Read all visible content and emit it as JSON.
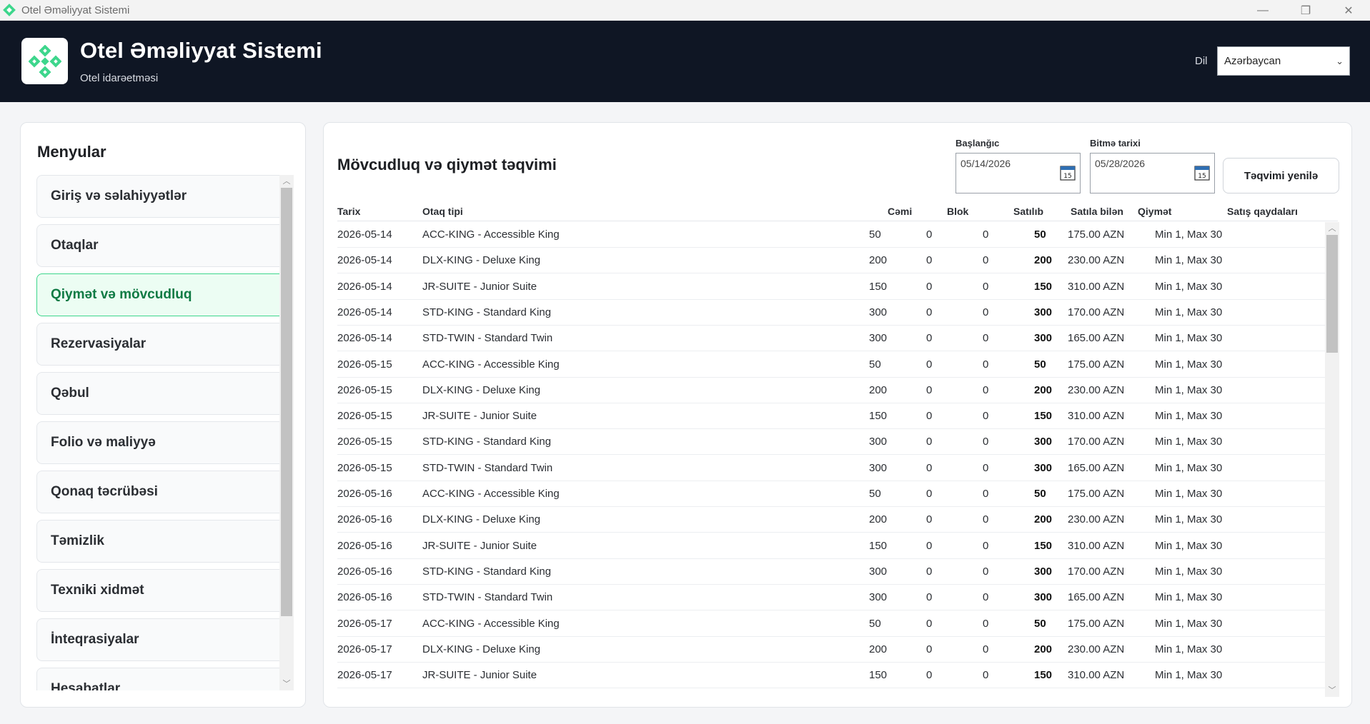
{
  "window": {
    "title": "Otel Əməliyyat Sistemi",
    "controls": {
      "minimize": "—",
      "restore": "❐",
      "close": "✕"
    }
  },
  "header": {
    "title": "Otel Əməliyyat Sistemi",
    "subtitle": "Otel idarəetməsi",
    "lang_label": "Dil",
    "lang_value": "Azərbaycan",
    "brand_color": "#0f1624",
    "logo_color": "#3dd68c"
  },
  "sidebar": {
    "title": "Menyular",
    "items": [
      {
        "label": "Giriş və səlahiyyətlər",
        "active": false
      },
      {
        "label": "Otaqlar",
        "active": false
      },
      {
        "label": "Qiymət və mövcudluq",
        "active": true
      },
      {
        "label": "Rezervasiyalar",
        "active": false
      },
      {
        "label": "Qəbul",
        "active": false
      },
      {
        "label": "Folio və maliyyə",
        "active": false
      },
      {
        "label": "Qonaq təcrübəsi",
        "active": false
      },
      {
        "label": "Təmizlik",
        "active": false
      },
      {
        "label": "Texniki xidmət",
        "active": false
      },
      {
        "label": "İnteqrasiyalar",
        "active": false
      },
      {
        "label": "Hesabatlar",
        "active": false
      }
    ]
  },
  "main": {
    "title": "Mövcudluq və qiymət təqvimi",
    "start_label": "Başlanğıc",
    "start_value": "05/14/2026",
    "end_label": "Bitmə tarixi",
    "end_value": "05/28/2026",
    "calendar_icon_text": "15",
    "refresh_label": "Təqvimi yenilə",
    "columns": [
      "Tarix",
      "Otaq tipi",
      "Cəmi",
      "Blok",
      "Satılıb",
      "Satıla bilən",
      "Qiymət",
      "Satış qaydaları"
    ],
    "rows": [
      [
        "2026-05-14",
        "ACC-KING - Accessible King",
        "50",
        "0",
        "0",
        "50",
        "175.00 AZN",
        "Min 1, Max 30"
      ],
      [
        "2026-05-14",
        "DLX-KING - Deluxe King",
        "200",
        "0",
        "0",
        "200",
        "230.00 AZN",
        "Min 1, Max 30"
      ],
      [
        "2026-05-14",
        "JR-SUITE - Junior Suite",
        "150",
        "0",
        "0",
        "150",
        "310.00 AZN",
        "Min 1, Max 30"
      ],
      [
        "2026-05-14",
        "STD-KING - Standard King",
        "300",
        "0",
        "0",
        "300",
        "170.00 AZN",
        "Min 1, Max 30"
      ],
      [
        "2026-05-14",
        "STD-TWIN - Standard Twin",
        "300",
        "0",
        "0",
        "300",
        "165.00 AZN",
        "Min 1, Max 30"
      ],
      [
        "2026-05-15",
        "ACC-KING - Accessible King",
        "50",
        "0",
        "0",
        "50",
        "175.00 AZN",
        "Min 1, Max 30"
      ],
      [
        "2026-05-15",
        "DLX-KING - Deluxe King",
        "200",
        "0",
        "0",
        "200",
        "230.00 AZN",
        "Min 1, Max 30"
      ],
      [
        "2026-05-15",
        "JR-SUITE - Junior Suite",
        "150",
        "0",
        "0",
        "150",
        "310.00 AZN",
        "Min 1, Max 30"
      ],
      [
        "2026-05-15",
        "STD-KING - Standard King",
        "300",
        "0",
        "0",
        "300",
        "170.00 AZN",
        "Min 1, Max 30"
      ],
      [
        "2026-05-15",
        "STD-TWIN - Standard Twin",
        "300",
        "0",
        "0",
        "300",
        "165.00 AZN",
        "Min 1, Max 30"
      ],
      [
        "2026-05-16",
        "ACC-KING - Accessible King",
        "50",
        "0",
        "0",
        "50",
        "175.00 AZN",
        "Min 1, Max 30"
      ],
      [
        "2026-05-16",
        "DLX-KING - Deluxe King",
        "200",
        "0",
        "0",
        "200",
        "230.00 AZN",
        "Min 1, Max 30"
      ],
      [
        "2026-05-16",
        "JR-SUITE - Junior Suite",
        "150",
        "0",
        "0",
        "150",
        "310.00 AZN",
        "Min 1, Max 30"
      ],
      [
        "2026-05-16",
        "STD-KING - Standard King",
        "300",
        "0",
        "0",
        "300",
        "170.00 AZN",
        "Min 1, Max 30"
      ],
      [
        "2026-05-16",
        "STD-TWIN - Standard Twin",
        "300",
        "0",
        "0",
        "300",
        "165.00 AZN",
        "Min 1, Max 30"
      ],
      [
        "2026-05-17",
        "ACC-KING - Accessible King",
        "50",
        "0",
        "0",
        "50",
        "175.00 AZN",
        "Min 1, Max 30"
      ],
      [
        "2026-05-17",
        "DLX-KING - Deluxe King",
        "200",
        "0",
        "0",
        "200",
        "230.00 AZN",
        "Min 1, Max 30"
      ],
      [
        "2026-05-17",
        "JR-SUITE - Junior Suite",
        "150",
        "0",
        "0",
        "150",
        "310.00 AZN",
        "Min 1, Max 30"
      ]
    ]
  }
}
